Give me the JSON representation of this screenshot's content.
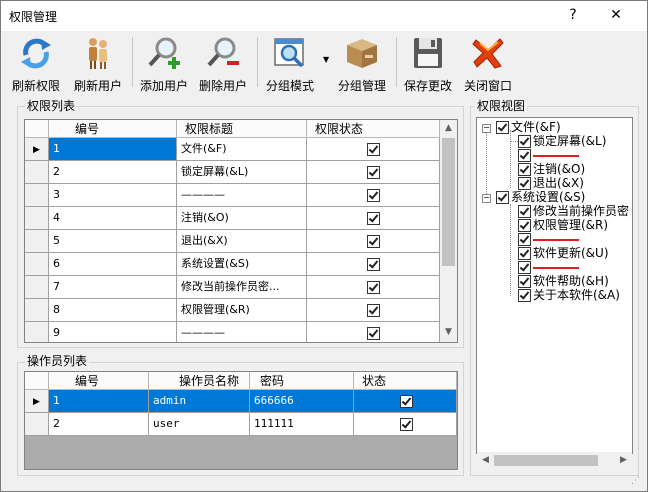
{
  "window": {
    "title": "权限管理",
    "help": "?",
    "close": "✕"
  },
  "toolbar": {
    "refresh_perm": "刷新权限",
    "refresh_user": "刷新用户",
    "add_user": "添加用户",
    "delete_user": "删除用户",
    "group_mode": "分组模式",
    "group_manage": "分组管理",
    "save_changes": "保存更改",
    "close_window": "关闭窗口"
  },
  "perm_list": {
    "title": "权限列表",
    "columns": [
      "编号",
      "权限标题",
      "权限状态"
    ],
    "rows": [
      {
        "id": "1",
        "title": "文件(&F)",
        "checked": true
      },
      {
        "id": "2",
        "title": "锁定屏幕(&L)",
        "checked": true
      },
      {
        "id": "3",
        "title": "————",
        "checked": true
      },
      {
        "id": "4",
        "title": "注销(&O)",
        "checked": true
      },
      {
        "id": "5",
        "title": "退出(&X)",
        "checked": true
      },
      {
        "id": "6",
        "title": "系统设置(&S)",
        "checked": true
      },
      {
        "id": "7",
        "title": "修改当前操作员密...",
        "checked": true
      },
      {
        "id": "8",
        "title": "权限管理(&R)",
        "checked": true
      },
      {
        "id": "9",
        "title": "————",
        "checked": true
      }
    ]
  },
  "operator_list": {
    "title": "操作员列表",
    "columns": [
      "编号",
      "操作员名称",
      "密码",
      "状态"
    ],
    "rows": [
      {
        "id": "1",
        "name": "admin",
        "password": "666666",
        "checked": true
      },
      {
        "id": "2",
        "name": "user",
        "password": "111111",
        "checked": true
      }
    ]
  },
  "perm_view": {
    "title": "权限视图",
    "nodes": {
      "file": "文件(&F)",
      "lock": "锁定屏幕(&L)",
      "logout": "注销(&O)",
      "exit": "退出(&X)",
      "settings": "系统设置(&S)",
      "change_pwd": "修改当前操作员密",
      "perm_manage": "权限管理(&R)",
      "update": "软件更新(&U)",
      "help": "软件帮助(&H)",
      "about": "关于本软件(&A)"
    }
  },
  "colors": {
    "selection": "#0078d7",
    "separator": "#e02020"
  }
}
